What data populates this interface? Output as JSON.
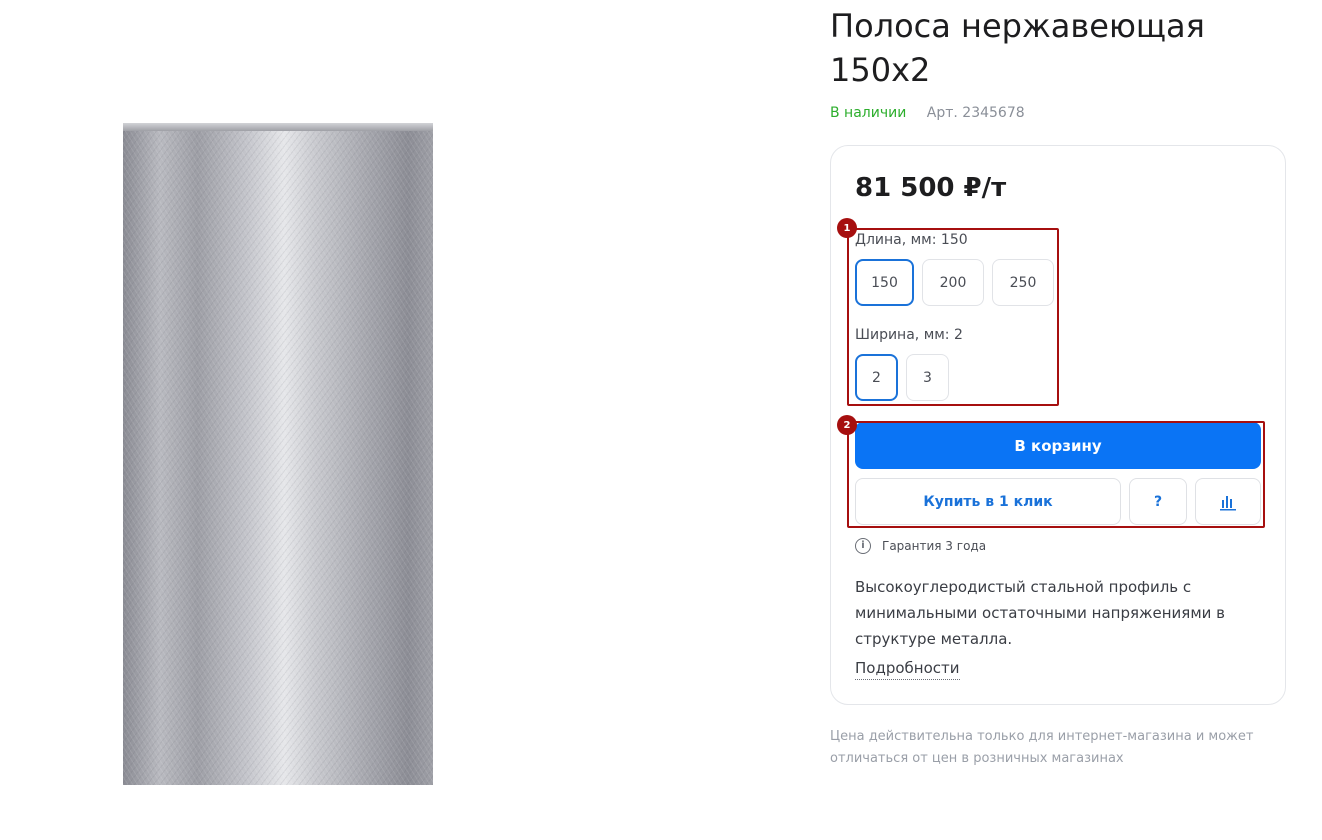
{
  "product": {
    "title": "Полоса нержавеющая 150x2",
    "stock_status": "В наличии",
    "sku": "Арт. 2345678",
    "image_alt": "stainless steel strip"
  },
  "pricing": {
    "price": "81 500 ₽/т"
  },
  "options": {
    "length": {
      "label": "Длина, мм: 150",
      "values": [
        "150",
        "200",
        "250"
      ],
      "selected": "150"
    },
    "width": {
      "label": "Ширина, мм: 2",
      "values": [
        "2",
        "3"
      ],
      "selected": "2"
    }
  },
  "actions": {
    "add_to_cart": "В корзину",
    "buy_one_click": "Купить в 1 клик",
    "question": "?",
    "compare_icon": "bar-chart-icon"
  },
  "warranty": {
    "icon": "info-icon",
    "text": "Гарантия 3 года"
  },
  "description": {
    "text": "Высокоуглеродистый стальной профиль с минимальными остаточными напряжениями в структуре металла.",
    "details_link": "Подробности"
  },
  "disclaimer": "Цена действительна только для интернет-магазина и может отличаться от цен в розничных магазинах",
  "annotations": [
    "1",
    "2"
  ],
  "colors": {
    "accent": "#0a74f5",
    "in_stock": "#2cae2c",
    "annotation": "#a60f0f"
  }
}
